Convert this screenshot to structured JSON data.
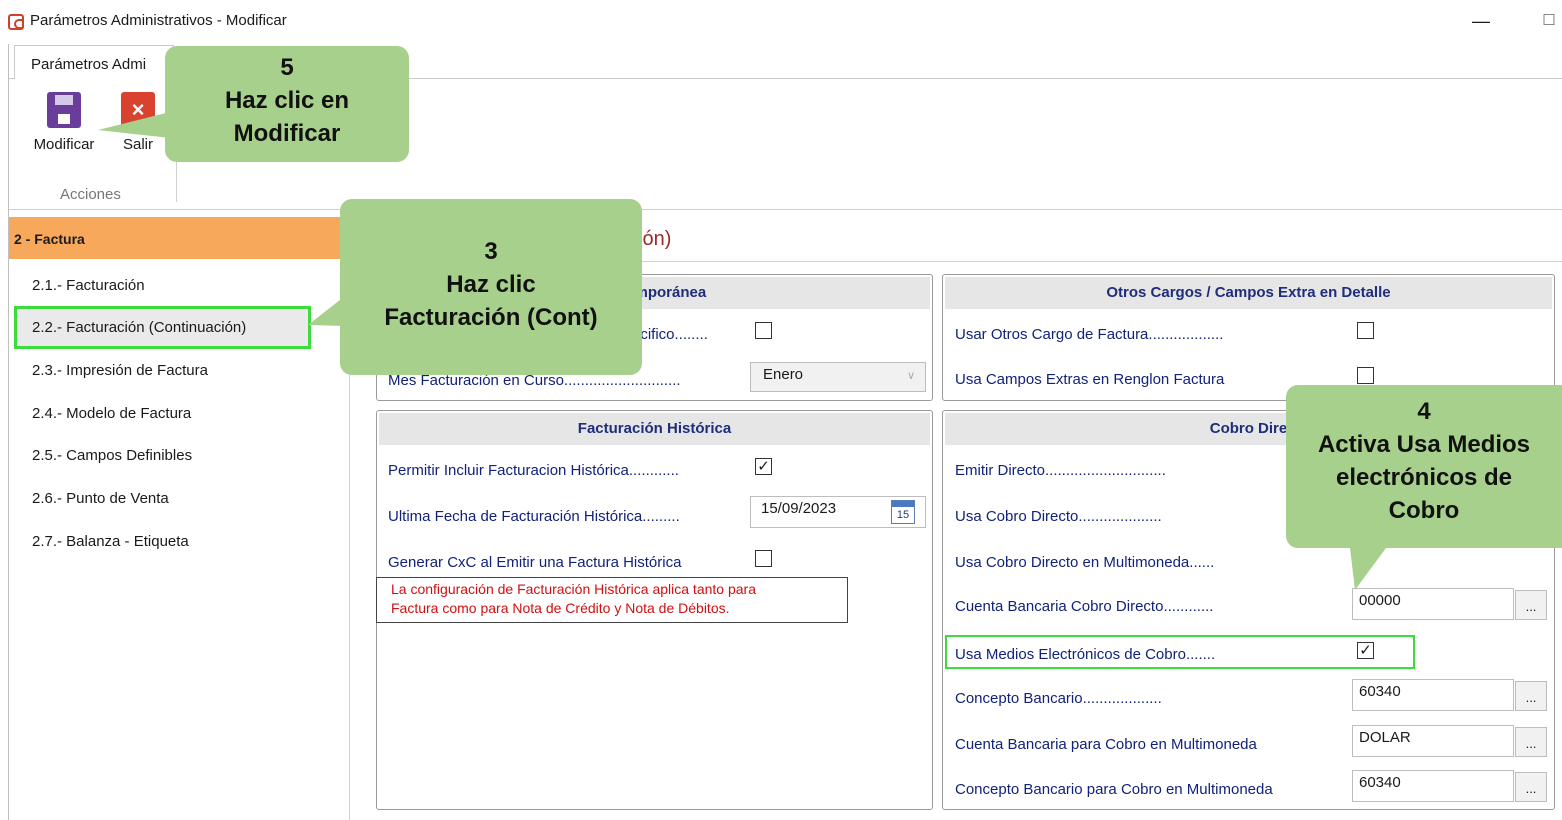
{
  "window": {
    "title": "Parámetros Administrativos - Modificar",
    "minimize": "—",
    "maximize": "☐"
  },
  "ribbon": {
    "tab": "Parámetros Admi",
    "modificar_label": "Modificar",
    "salir_label": "Salir",
    "group_label": "Acciones"
  },
  "sidebar": {
    "header": "2 - Factura",
    "items": [
      "2.1.- Facturación",
      "2.2.- Facturación (Continuación)",
      "2.3.- Impresión de Factura",
      "2.4.- Modelo de Factura",
      "2.5.- Campos Definibles",
      "2.6.- Punto de Venta",
      "2.7.- Balanza - Etiqueta"
    ]
  },
  "main": {
    "section_title": "ción)",
    "extemporanea": {
      "title": "Extemporánea",
      "row1_label": "ecifico........",
      "row2_label": "Mes Facturación en Curso............................",
      "mes_value": "Enero"
    },
    "otros_cargos": {
      "title": "Otros Cargos / Campos Extra en Detalle",
      "row1_label": "Usar Otros Cargo de Factura..................",
      "row2_label": "Usa Campos Extras en Renglon Factura"
    },
    "historica": {
      "title": "Facturación Histórica",
      "row1_label": "Permitir Incluir Facturacion Histórica............",
      "row1_checked": "✓",
      "row2_label": "Ultima Fecha de Facturación Histórica.........",
      "date_value": "15/09/2023",
      "calendar_day": "15",
      "row3_label": "Generar CxC al Emitir una Factura Histórica",
      "note_line1": "La configuración de Facturación Histórica aplica tanto para",
      "note_line2": "Factura como para Nota de Crédito y Nota de Débitos."
    },
    "cobro": {
      "title": "Cobro Dire",
      "emitir_label": "Emitir Directo.............................",
      "usa_cobro_label": "Usa Cobro Directo....................",
      "multimoneda_label": "Usa Cobro Directo en Multimoneda......",
      "cuenta_label": "Cuenta Bancaria Cobro Directo............",
      "cuenta_value": "00000",
      "medios_label": "Usa Medios Electrónicos de Cobro.......",
      "medios_checked": "✓",
      "concepto_label": "Concepto Bancario...................",
      "concepto_value": "60340",
      "cuenta_mm_label": "Cuenta Bancaria para Cobro en Multimoneda",
      "cuenta_mm_value": "DOLAR",
      "concepto_mm_label": "Concepto Bancario para Cobro en Multimoneda",
      "concepto_mm_value": "60340",
      "dots": "..."
    }
  },
  "callouts": {
    "step5": {
      "num": "5",
      "line1": "Haz clic en",
      "line2": "Modificar"
    },
    "step3": {
      "num": "3",
      "line1": "Haz clic",
      "line2": "Facturación (Cont)"
    },
    "step4": {
      "num": "4",
      "line1": "Activa Usa Medios",
      "line2": "electrónicos de",
      "line3": "Cobro"
    }
  },
  "colors": {
    "callout": "#a8d08d",
    "highlight": "#3ddc3d",
    "sidebar_header": "#f8a85a",
    "label": "#12227a",
    "note": "#d01010"
  }
}
